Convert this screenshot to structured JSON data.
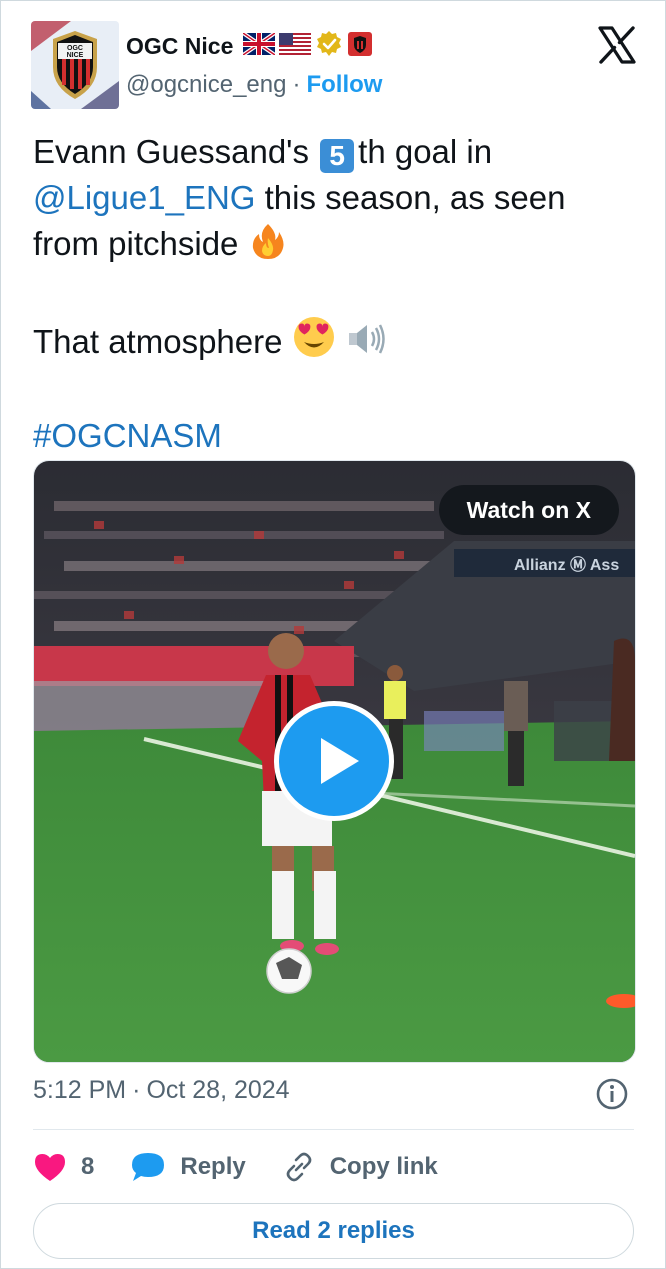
{
  "header": {
    "display_name": "OGC Nice",
    "handle": "@ogcnice_eng",
    "separator": "·",
    "follow_label": "Follow",
    "avatar_text_top": "OGC",
    "avatar_text_bottom": "NICE",
    "icons": [
      "uk-flag-icon",
      "us-flag-icon",
      "verified-gold-badge-icon",
      "ogc-nice-affiliate-badge-icon",
      "x-logo-icon"
    ]
  },
  "tweet": {
    "line1_a": "Evann Guessand's",
    "keycap": "5",
    "line1_b": "th goal in",
    "mention": "@Ligue1_ENG",
    "line2_b": "this season, as seen",
    "line3": "from pitchside",
    "line4": "That atmosphere",
    "hashtag": "#OGCNASM",
    "emojis": [
      "fire-emoji",
      "heart-eyes-emoji",
      "speaker-emoji"
    ]
  },
  "media": {
    "watch_label": "Watch on X",
    "stadium_banner": "Allianz Ⓜ Ass",
    "type": "video"
  },
  "meta": {
    "time": "5:12 PM",
    "separator": "·",
    "date": "Oct 28, 2024"
  },
  "actions": {
    "like_count": "8",
    "reply_label": "Reply",
    "copy_link_label": "Copy link"
  },
  "read_replies_label": "Read 2 replies",
  "colors": {
    "accent": "#1d9bf0",
    "link": "#1d74bd",
    "like": "#f91880",
    "muted": "#536471"
  }
}
